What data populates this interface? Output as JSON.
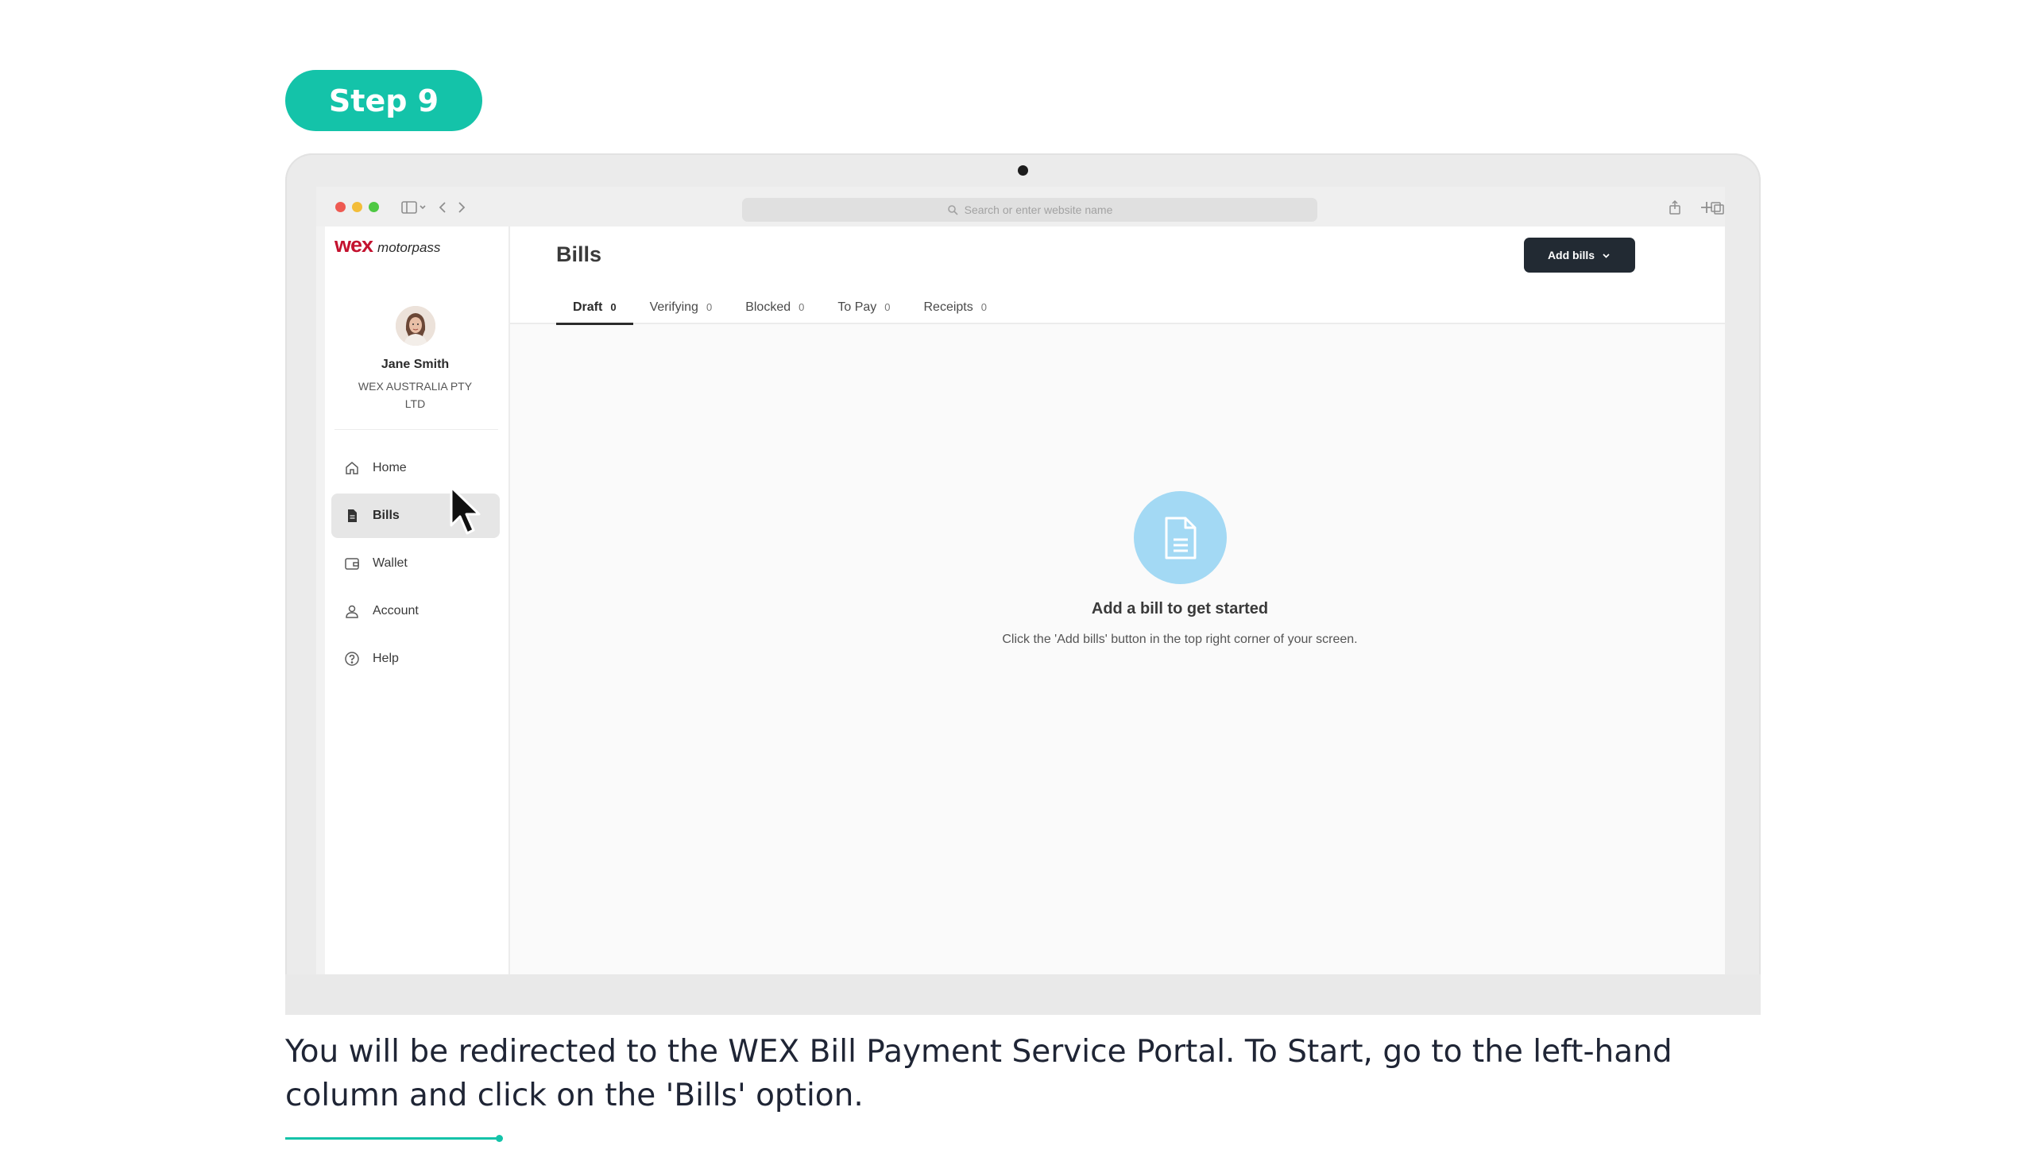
{
  "step_label": "Step 9",
  "browser": {
    "url_placeholder": "Search or enter website name"
  },
  "app": {
    "logo_wex": "wex",
    "logo_product": "motorpass",
    "user": {
      "name": "Jane Smith",
      "company": "WEX AUSTRALIA PTY LTD"
    },
    "nav": [
      {
        "label": "Home",
        "icon": "home-icon",
        "active": false
      },
      {
        "label": "Bills",
        "icon": "document-icon",
        "active": true
      },
      {
        "label": "Wallet",
        "icon": "wallet-icon",
        "active": false
      },
      {
        "label": "Account",
        "icon": "user-icon",
        "active": false
      },
      {
        "label": "Help",
        "icon": "help-circle-icon",
        "active": false
      }
    ],
    "page_title": "Bills",
    "add_bills_label": "Add bills",
    "tabs": [
      {
        "label": "Draft",
        "count": "0",
        "active": true
      },
      {
        "label": "Verifying",
        "count": "0",
        "active": false
      },
      {
        "label": "Blocked",
        "count": "0",
        "active": false
      },
      {
        "label": "To Pay",
        "count": "0",
        "active": false
      },
      {
        "label": "Receipts",
        "count": "0",
        "active": false
      }
    ],
    "empty_state": {
      "title": "Add a bill to get started",
      "description": "Click the 'Add bills' button in the top right corner of your screen."
    }
  },
  "caption": "You will be redirected to the WEX Bill Payment Service Portal. To Start, go to the left-hand column and click on the 'Bills' option.",
  "colors": {
    "accent": "#14c3a9",
    "brand_red": "#c4122f",
    "button_dark": "#222a33",
    "empty_icon_bg": "#a3d9f4"
  }
}
